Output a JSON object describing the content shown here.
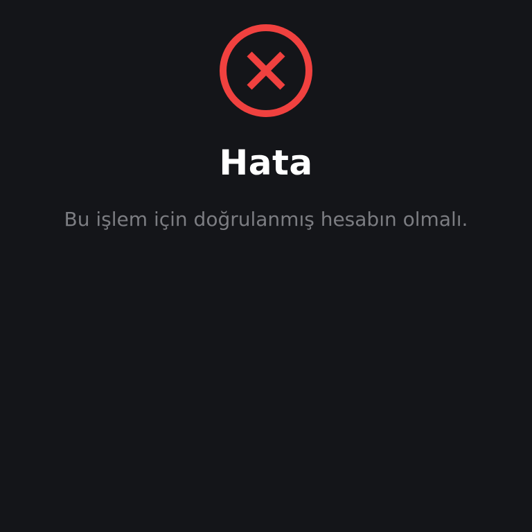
{
  "dialog": {
    "icon": "error-x-circle-icon",
    "title": "Hata",
    "message": "Bu işlem için doğrulanmış hesabın olmalı."
  },
  "colors": {
    "background": "#141519",
    "error_red": "#f0413f",
    "title_text": "#ffffff",
    "message_text": "#7c7d82"
  }
}
